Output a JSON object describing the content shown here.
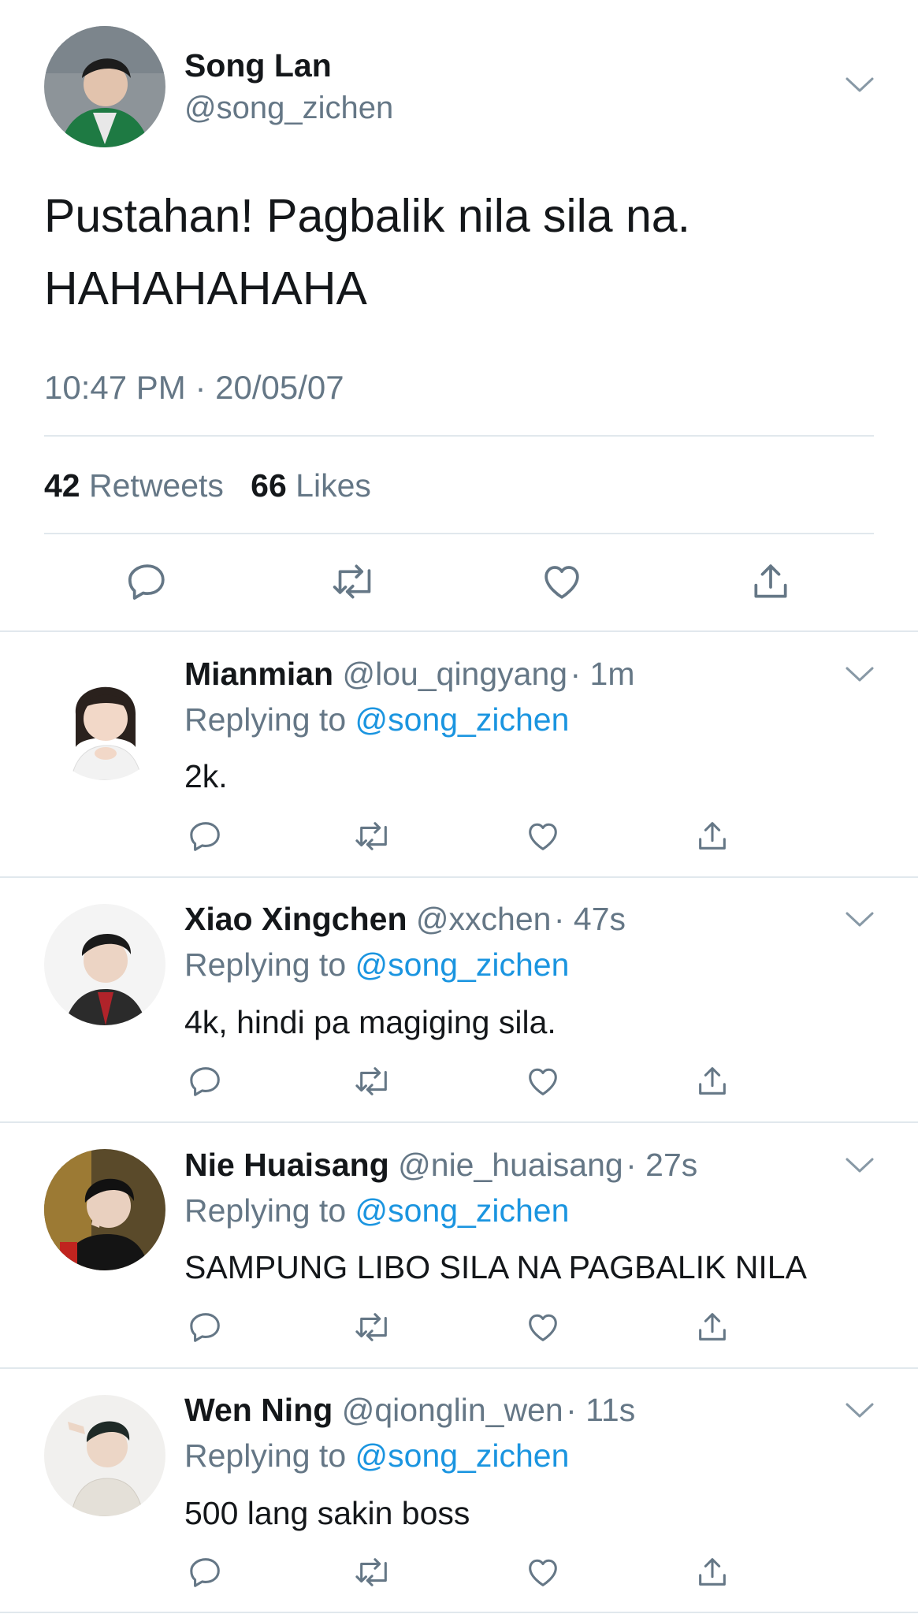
{
  "main_tweet": {
    "author_name": "Song Lan",
    "author_handle": "@song_zichen",
    "text_line1": "Pustahan! Pagbalik nila sila na.",
    "text_line2": "HAHAHAHAHA",
    "timestamp": "10:47 PM · 20/05/07",
    "retweets_count": "42",
    "retweets_label": "Retweets",
    "likes_count": "66",
    "likes_label": "Likes"
  },
  "replies": [
    {
      "name": "Mianmian",
      "handle": "@lou_qingyang",
      "time": "· 1m",
      "replying_label": "Replying to",
      "replying_handle": "@song_zichen",
      "text": "2k."
    },
    {
      "name": "Xiao Xingchen",
      "handle": "@xxchen",
      "time": "· 47s",
      "replying_label": "Replying to",
      "replying_handle": "@song_zichen",
      "text": "4k, hindi pa magiging sila."
    },
    {
      "name": "Nie Huaisang",
      "handle": "@nie_huaisang",
      "time": "· 27s",
      "replying_label": "Replying to",
      "replying_handle": "@song_zichen",
      "text": "SAMPUNG LIBO SILA NA PAGBALIK NILA"
    },
    {
      "name": "Wen Ning",
      "handle": "@qionglin_wen",
      "time": "· 11s",
      "replying_label": "Replying to",
      "replying_handle": "@song_zichen",
      "text": "500 lang sakin boss"
    }
  ],
  "icons": {
    "reply": "reply-icon",
    "retweet": "retweet-icon",
    "like": "heart-icon",
    "share": "share-icon",
    "menu": "chevron-down-icon"
  },
  "colors": {
    "text": "#14171a",
    "muted": "#657786",
    "link": "#1b95e0",
    "divider": "#e1e8ed"
  }
}
